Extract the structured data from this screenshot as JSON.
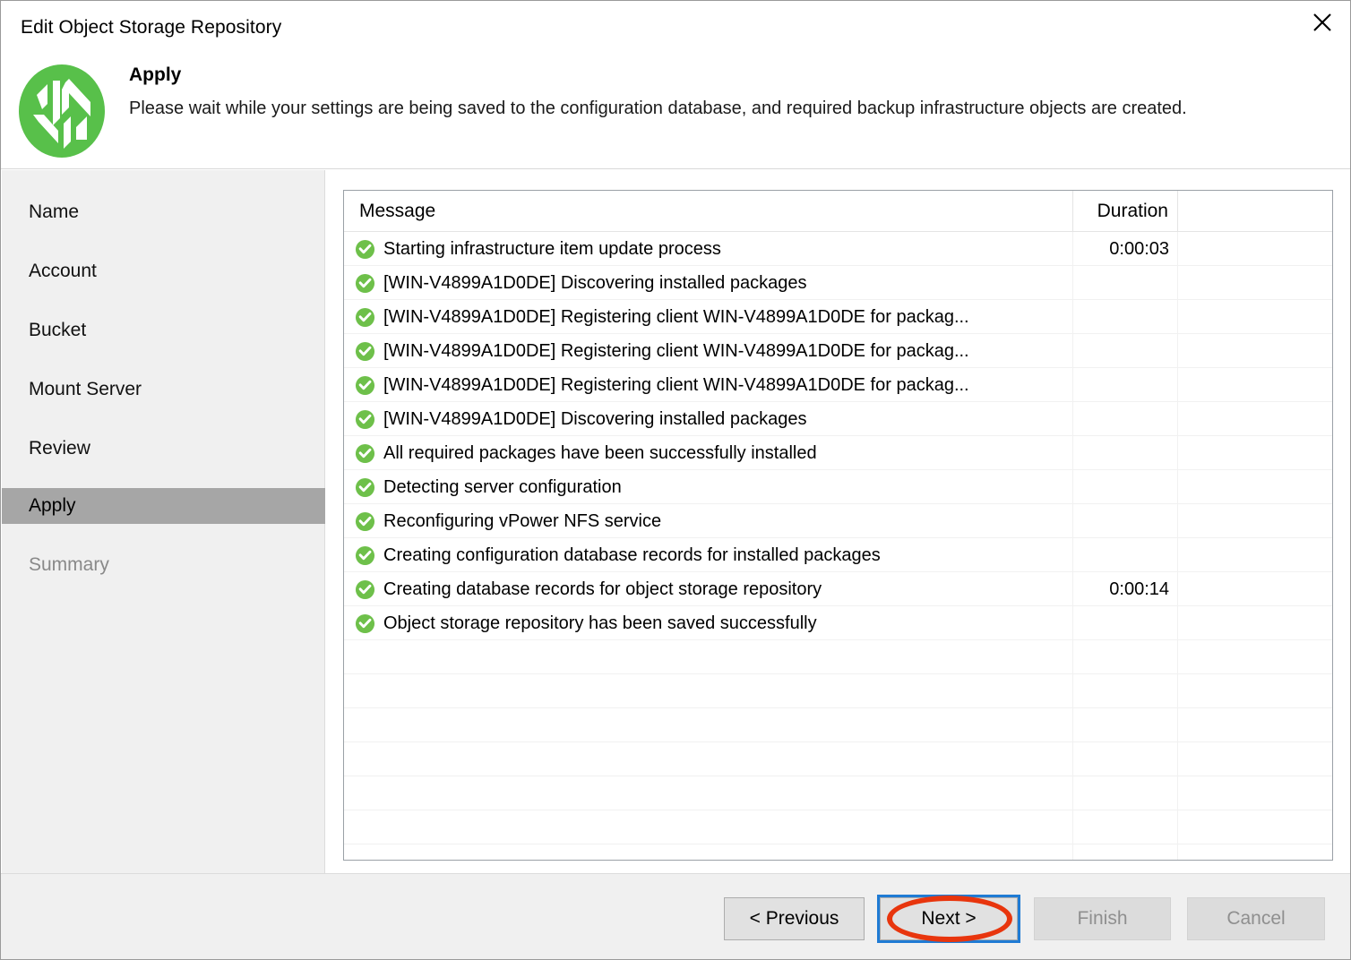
{
  "window": {
    "title": "Edit Object Storage Repository",
    "close_icon": "close-icon"
  },
  "header": {
    "logo_icon": "veeam-logo-icon",
    "title": "Apply",
    "description": "Please wait while your settings are being saved to the configuration database, and required backup infrastructure objects are created."
  },
  "sidebar": {
    "items": [
      {
        "label": "Name",
        "state": "enabled"
      },
      {
        "label": "Account",
        "state": "enabled"
      },
      {
        "label": "Bucket",
        "state": "enabled"
      },
      {
        "label": "Mount Server",
        "state": "enabled"
      },
      {
        "label": "Review",
        "state": "enabled"
      },
      {
        "label": "Apply",
        "state": "selected"
      },
      {
        "label": "Summary",
        "state": "disabled"
      }
    ]
  },
  "list": {
    "columns": [
      "Message",
      "Duration",
      ""
    ],
    "rows": [
      {
        "status": "success",
        "message": "Starting infrastructure item update process",
        "duration": "0:00:03"
      },
      {
        "status": "success",
        "message": "[WIN-V4899A1D0DE] Discovering installed packages",
        "duration": ""
      },
      {
        "status": "success",
        "message": "[WIN-V4899A1D0DE] Registering client WIN-V4899A1D0DE for packag...",
        "duration": ""
      },
      {
        "status": "success",
        "message": "[WIN-V4899A1D0DE] Registering client WIN-V4899A1D0DE for packag...",
        "duration": ""
      },
      {
        "status": "success",
        "message": "[WIN-V4899A1D0DE] Registering client WIN-V4899A1D0DE for packag...",
        "duration": ""
      },
      {
        "status": "success",
        "message": "[WIN-V4899A1D0DE] Discovering installed packages",
        "duration": ""
      },
      {
        "status": "success",
        "message": "All required packages have been successfully installed",
        "duration": ""
      },
      {
        "status": "success",
        "message": "Detecting server configuration",
        "duration": ""
      },
      {
        "status": "success",
        "message": "Reconfiguring vPower NFS service",
        "duration": ""
      },
      {
        "status": "success",
        "message": "Creating configuration database records for installed packages",
        "duration": ""
      },
      {
        "status": "success",
        "message": "Creating database records for object storage repository",
        "duration": "0:00:14"
      },
      {
        "status": "success",
        "message": "Object storage repository has been saved successfully",
        "duration": ""
      },
      {
        "status": "empty",
        "message": "",
        "duration": ""
      },
      {
        "status": "empty",
        "message": "",
        "duration": ""
      },
      {
        "status": "empty",
        "message": "",
        "duration": ""
      },
      {
        "status": "empty",
        "message": "",
        "duration": ""
      },
      {
        "status": "empty",
        "message": "",
        "duration": ""
      },
      {
        "status": "empty",
        "message": "",
        "duration": ""
      },
      {
        "status": "empty",
        "message": "",
        "duration": ""
      }
    ]
  },
  "footer": {
    "previous": "< Previous",
    "next": "Next >",
    "finish": "Finish",
    "cancel": "Cancel"
  },
  "colors": {
    "accent_green": "#6ec04a",
    "selected_nav": "#a6a6a6",
    "focus_blue": "#1f7bd4",
    "annotation_red": "#e8350d"
  }
}
